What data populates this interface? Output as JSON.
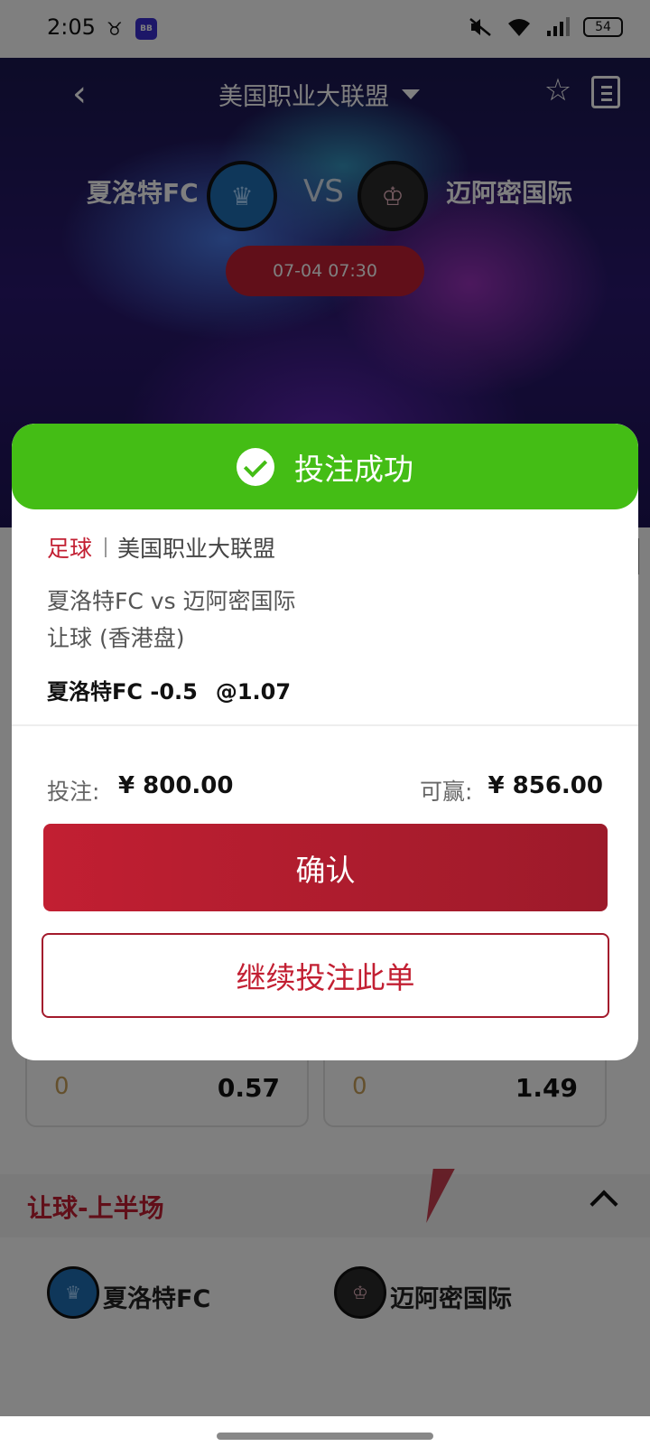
{
  "status_bar": {
    "time": "2:05",
    "battery": "54",
    "app_badge": "BB"
  },
  "header": {
    "league": "美国职业大联盟"
  },
  "match": {
    "home": "夏洛特FC",
    "away": "迈阿密国际",
    "vs": "VS",
    "kickoff": "07-04 07:30"
  },
  "background": {
    "odds_row": [
      {
        "line": "0",
        "odds": "0.57"
      },
      {
        "line": "0",
        "odds": "1.49"
      }
    ],
    "section_title": "让球-上半场",
    "home": "夏洛特FC",
    "away": "迈阿密国际"
  },
  "modal": {
    "title": "投注成功",
    "sport": "足球",
    "league": "美国职业大联盟",
    "match": "夏洛特FC vs 迈阿密国际",
    "market": "让球 (香港盘)",
    "pick": "夏洛特FC -0.5",
    "odds": "@1.07",
    "stake_label": "投注:",
    "stake": "¥ 800.00",
    "win_label": "可赢:",
    "win": "¥ 856.00",
    "confirm": "确认",
    "continue": "继续投注此单"
  },
  "colors": {
    "accent": "#c21f32",
    "success": "#44bd15"
  }
}
